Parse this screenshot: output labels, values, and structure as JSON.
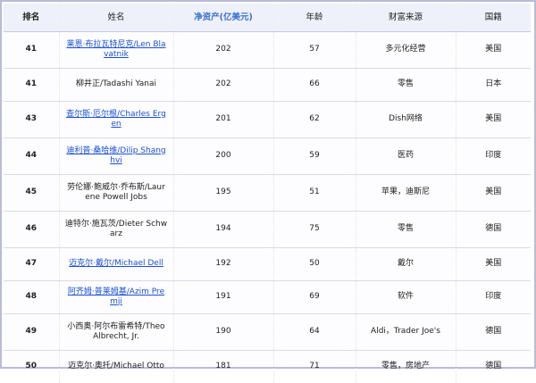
{
  "headers": {
    "rank": "排名",
    "name": "姓名",
    "net_worth": "净资产(亿美元)",
    "age": "年龄",
    "source": "财富来源",
    "country": "国籍"
  },
  "rows": [
    {
      "rank": "41",
      "name": "莱恩·布拉瓦特尼克/Len Blavatnik",
      "linked": true,
      "net_worth": "202",
      "age": "57",
      "source": "多元化经营",
      "country": "美国"
    },
    {
      "rank": "41",
      "name": "柳井正/Tadashi Yanai",
      "linked": false,
      "net_worth": "202",
      "age": "66",
      "source": "零售",
      "country": "日本"
    },
    {
      "rank": "43",
      "name": "查尔斯·厄尔根/Charles Ergen",
      "linked": true,
      "net_worth": "201",
      "age": "62",
      "source": "Dish网络",
      "country": "美国"
    },
    {
      "rank": "44",
      "name": "迪利普·桑哈维/Dilip Shanghvi",
      "linked": true,
      "net_worth": "200",
      "age": "59",
      "source": "医药",
      "country": "印度"
    },
    {
      "rank": "45",
      "name": "劳伦娜·鲍威尔·乔布斯/Laurene Powell Jobs",
      "linked": false,
      "net_worth": "195",
      "age": "51",
      "source": "苹果，迪斯尼",
      "country": "美国"
    },
    {
      "rank": "46",
      "name": "迪特尔·施瓦茨/Dieter Schwarz",
      "linked": false,
      "net_worth": "194",
      "age": "75",
      "source": "零售",
      "country": "德国"
    },
    {
      "rank": "47",
      "name": "迈克尔·戴尔/Michael Dell",
      "linked": true,
      "net_worth": "192",
      "age": "50",
      "source": "戴尔",
      "country": "美国"
    },
    {
      "rank": "48",
      "name": "阿齐姆·普莱姆基/Azim Premji",
      "linked": true,
      "net_worth": "191",
      "age": "69",
      "source": "软件",
      "country": "印度"
    },
    {
      "rank": "49",
      "name": "小西奥·阿尔布雷希特/Theo Albrecht, Jr.",
      "linked": false,
      "net_worth": "190",
      "age": "64",
      "source": "Aldi，Trader Joe's",
      "country": "德国"
    },
    {
      "rank": "50",
      "name": "迈克尔·奥托/Michael Otto",
      "linked": false,
      "net_worth": "181",
      "age": "71",
      "source": "零售，房地产",
      "country": "德国"
    }
  ]
}
